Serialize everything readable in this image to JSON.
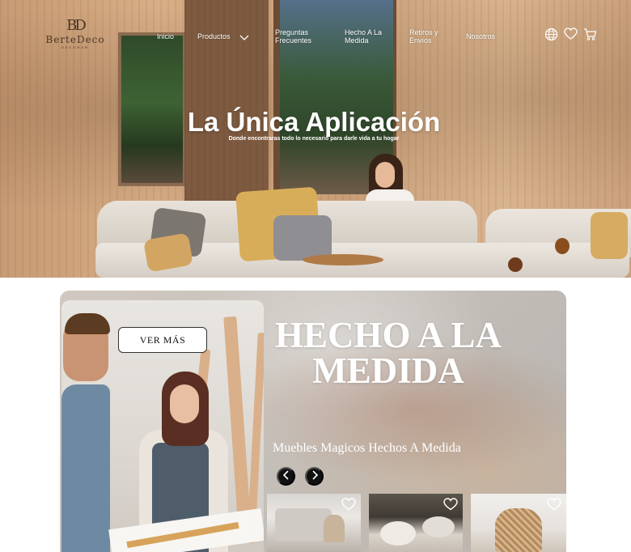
{
  "brand": {
    "monogram": "BD",
    "name": "BerteDeco",
    "tagline": "DECORAR"
  },
  "nav": {
    "items": [
      {
        "label": "Inicio"
      },
      {
        "label": "Productos"
      },
      {
        "label": "Preguntas\nFrecuentes"
      },
      {
        "label": "Hecho A La\nMedida"
      },
      {
        "label": "Retiros y\nEnvíos"
      },
      {
        "label": "Nosotros"
      }
    ],
    "icons": [
      "globe-icon",
      "heart-icon",
      "cart-icon"
    ]
  },
  "hero": {
    "title_bold": "La Única",
    "title_rest": "Aplicación",
    "subtitle": "Donde encontraras todo lo necesario para darle vida a tu hogar"
  },
  "feature": {
    "button_label": "VER MÁS",
    "title": "HECHO A LA MEDIDA",
    "subtitle": "Muebles Magicos Hechos A Medida",
    "carousel": {
      "prev_icon": "chevron-left-icon",
      "next_icon": "chevron-right-icon"
    },
    "thumbnails": [
      {
        "fav_icon": "heart-icon"
      },
      {
        "fav_icon": "heart-icon"
      },
      {
        "fav_icon": "heart-icon"
      }
    ]
  },
  "colors": {
    "dark": "#111111",
    "text_light": "#ffffff",
    "brand_brown": "#4a3526"
  }
}
